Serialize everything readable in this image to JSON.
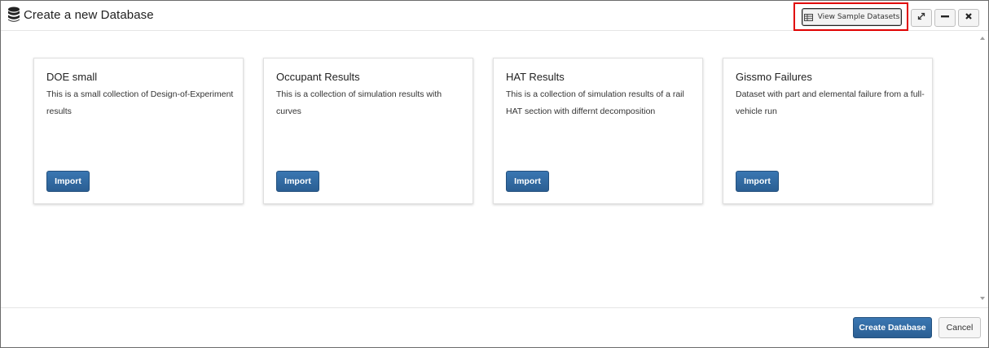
{
  "dialog": {
    "title": "Create a new Database",
    "title_icon": "database-icon"
  },
  "toolbar": {
    "view_samples_label": "View Sample Datasets",
    "view_samples_icon": "table-icon",
    "expand_icon": "expand-icon",
    "minimize_icon": "minimize-icon",
    "close_icon": "close-icon"
  },
  "datasets": [
    {
      "title": "DOE small",
      "description": "This is a small collection of Design-of-Experiment results",
      "import_label": "Import"
    },
    {
      "title": "Occupant Results",
      "description": "This is a collection of simulation results with curves",
      "import_label": "Import"
    },
    {
      "title": "HAT Results",
      "description": "This is a collection of simulation results of a rail HAT section with differnt decomposition",
      "import_label": "Import"
    },
    {
      "title": "Gissmo Failures",
      "description": "Dataset with part and elemental failure from a full-vehicle run",
      "import_label": "Import"
    }
  ],
  "footer": {
    "create_label": "Create Database",
    "cancel_label": "Cancel"
  },
  "colors": {
    "primary_button": "#2f689f",
    "highlight": "#e00000"
  }
}
